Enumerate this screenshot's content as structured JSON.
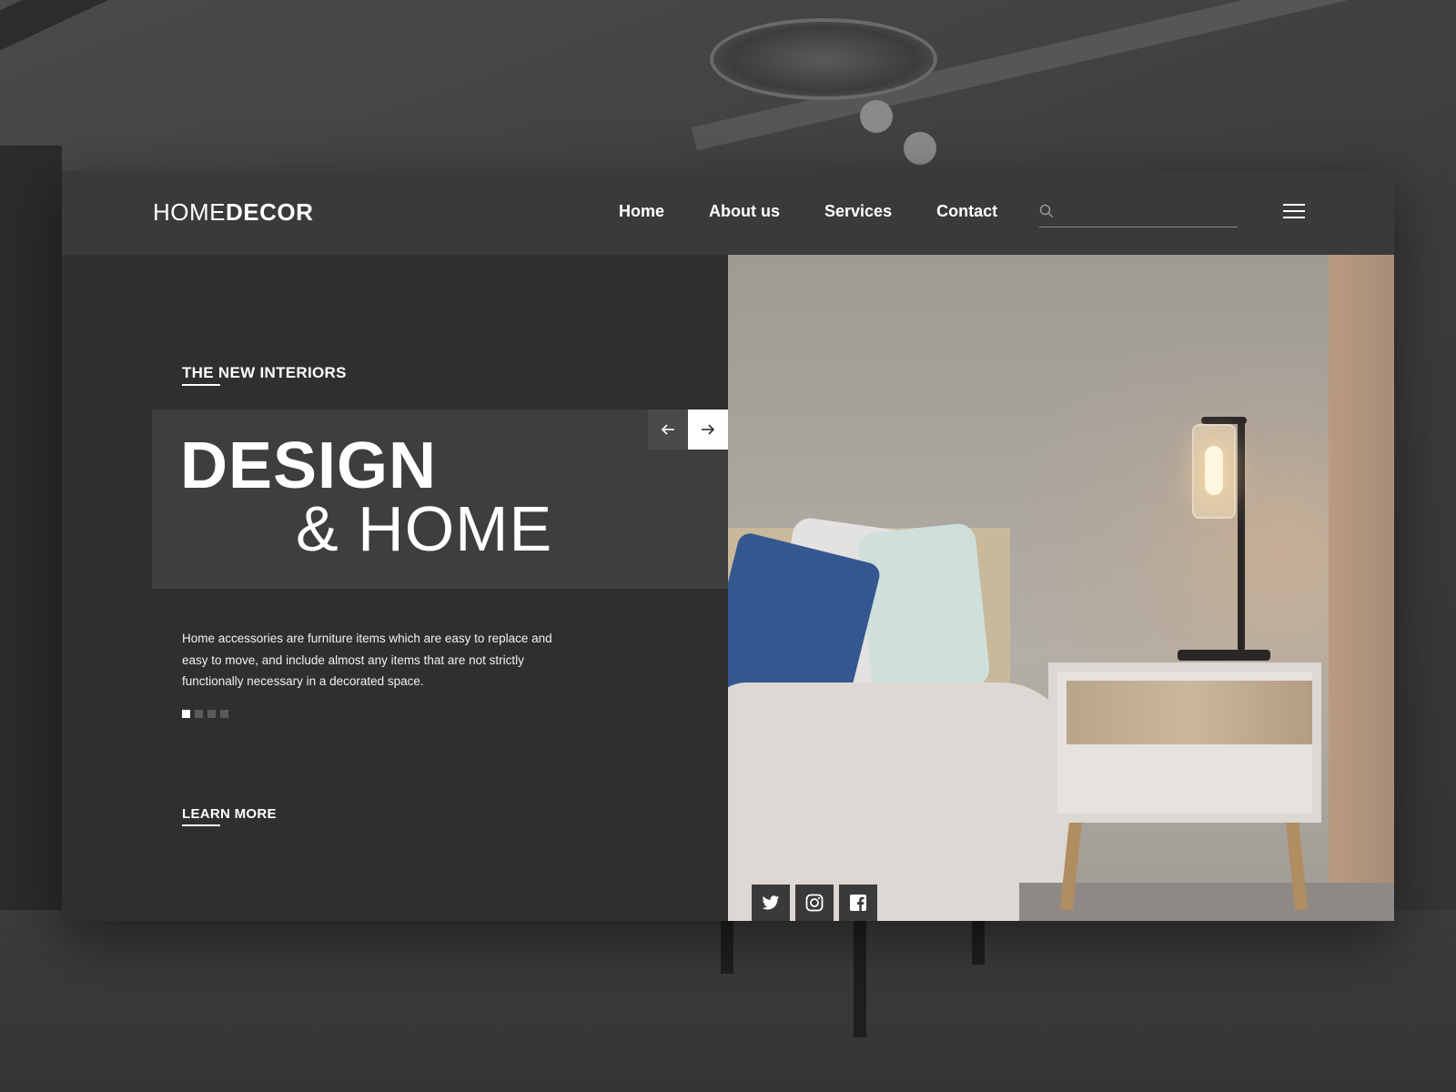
{
  "header": {
    "logo_light": "HOME",
    "logo_bold": "DECOR",
    "nav": [
      {
        "label": "Home"
      },
      {
        "label": "About us"
      },
      {
        "label": "Services"
      },
      {
        "label": "Contact"
      }
    ],
    "search": {
      "value": "",
      "placeholder": ""
    }
  },
  "hero": {
    "eyebrow": "THE NEW INTERIORS",
    "title_line1": "DESIGN",
    "title_line2": "& HOME",
    "description": "Home accessories are furniture items which are easy to replace and easy to move, and include almost any items that are not strictly functionally necessary in a decorated space.",
    "slide_count": 4,
    "active_slide": 1,
    "cta_label": "LEARN MORE"
  },
  "social": {
    "icons": [
      "twitter-icon",
      "instagram-icon",
      "facebook-icon"
    ]
  },
  "colors": {
    "panel": "#2f2f2f",
    "header": "#3a3a3a",
    "title_box": "#3e3e3e",
    "accent": "#ffffff"
  }
}
